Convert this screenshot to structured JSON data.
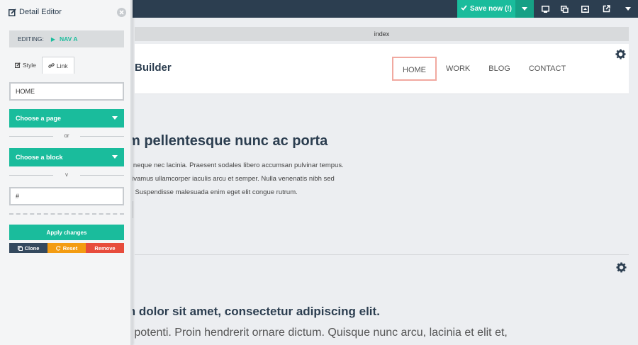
{
  "topbar": {
    "save_label": "Save now (!)",
    "icons": [
      "desktop-icon",
      "tablet-icon",
      "preview-icon",
      "external-link-icon",
      "menu-caret-icon"
    ]
  },
  "canvas": {
    "tab_title": "index",
    "brand": "Builder",
    "nav": [
      "HOME",
      "WORK",
      "BLOG",
      "CONTACT"
    ],
    "hero_heading": "m pellentesque nunc ac porta",
    "hero_lines": [
      "n neque nec lacinia. Praesent sodales libero accumsan pulvinar tempus.",
      "Vivamus ullamcorper iaculis arcu et semper. Nulla venenatis nibh sed",
      "n. Suspendisse malesuada enim eget elit congue rutrum."
    ],
    "sec2_heading": "m dolor sit amet, consectetur adipiscing elit.",
    "sec2_text": "e potenti. Proin hendrerit ornare dictum. Quisque nunc arcu, lacinia et elit et,"
  },
  "sidebar": {
    "title": "Detail Editor",
    "editing_label": "EDITING:",
    "editing_target": "NAV A",
    "tab_style": "Style",
    "tab_link": "Link",
    "link_text_value": "HOME",
    "choose_page": "Choose a page",
    "or_label": "or",
    "choose_block": "Choose a block",
    "v_label": "v",
    "url_value": "#",
    "apply_label": "Apply changes",
    "clone_label": "Clone",
    "reset_label": "Reset",
    "remove_label": "Remove"
  },
  "colors": {
    "accent": "#1abc9c",
    "topbar": "#2c3e50",
    "reset": "#f39c12",
    "remove": "#e74c3c"
  }
}
